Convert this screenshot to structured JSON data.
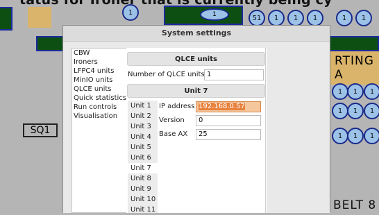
{
  "background": {
    "top_text": "tatus for Ironer that is currently being cy",
    "circle_labels": [
      "1",
      "1",
      "51",
      "1",
      "1",
      "1",
      "1",
      "1"
    ],
    "right_circle_labels": [
      "1",
      "1",
      "1",
      "1",
      "1",
      "1",
      "1",
      "1",
      "1"
    ],
    "sq1_label": "SQ1",
    "right_banner": "RTING A",
    "bottom_right_text": "BELT 8"
  },
  "dialog": {
    "title": "System settings",
    "nav_items": [
      "CBW",
      "Ironers",
      "LFPC4 units",
      "MinIO units",
      "QLCE units",
      "Quick statistics",
      "Run controls",
      "Visualisation"
    ],
    "selected_nav": "QLCE units",
    "section_header": "QLCE units",
    "num_units_label": "Number of QLCE units",
    "num_units_value": "1",
    "unit_header": "Unit 7",
    "units": [
      "Unit 1",
      "Unit 2",
      "Unit 3",
      "Unit 4",
      "Unit 5",
      "Unit 6",
      "Unit 7",
      "Unit 8",
      "Unit 9",
      "Unit 10",
      "Unit 11"
    ],
    "selected_unit": "Unit 7",
    "fields": {
      "ip_label": "IP address",
      "ip_value": "192.168.0.57",
      "version_label": "Version",
      "version_value": "0",
      "base_ax_label": "Base AX",
      "base_ax_value": "25"
    }
  },
  "colors": {
    "highlight": "#f5c79c",
    "green_block": "#0d4f13",
    "circle_fill": "#9cc2e8"
  }
}
